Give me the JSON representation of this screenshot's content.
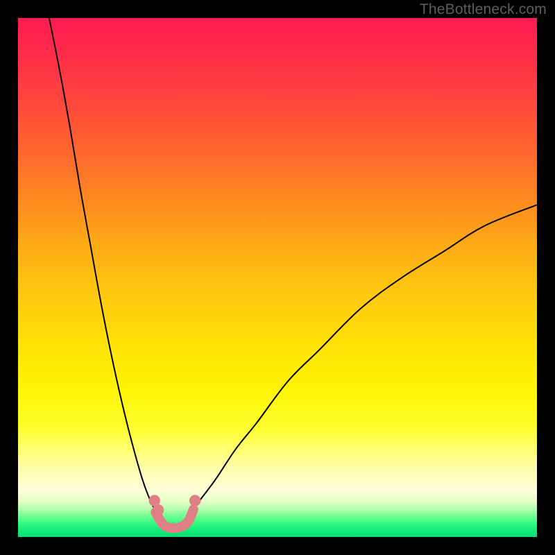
{
  "watermark": "TheBottleneck.com",
  "chart_data": {
    "type": "line",
    "title": "",
    "xlabel": "",
    "ylabel": "",
    "xlim": [
      0,
      100
    ],
    "ylim": [
      0,
      100
    ],
    "grid": false,
    "legend": false,
    "series": [
      {
        "name": "left-branch",
        "stroke": "#000000",
        "stroke_width": 2,
        "x": [
          6,
          8,
          10,
          12,
          14,
          16,
          18,
          20,
          22,
          24,
          25.5,
          27
        ],
        "y": [
          100,
          90,
          79,
          67,
          56,
          45,
          35,
          26,
          18,
          11,
          7,
          4
        ]
      },
      {
        "name": "right-branch",
        "stroke": "#000000",
        "stroke_width": 2,
        "x": [
          33,
          35,
          38,
          42,
          46,
          52,
          58,
          66,
          74,
          82,
          90,
          100
        ],
        "y": [
          4,
          7,
          11,
          17,
          22,
          30,
          36,
          44,
          50,
          55,
          60,
          64
        ]
      },
      {
        "name": "bottom-connector",
        "stroke": "#e08086",
        "stroke_width": 7,
        "x": [
          26.5,
          27.5,
          28.5,
          30,
          31.5,
          32.8,
          33.8
        ],
        "y": [
          4.8,
          3.0,
          2.0,
          1.7,
          2.0,
          3.0,
          5.3
        ]
      }
    ],
    "markers": [
      {
        "label": "left-dot-upper",
        "x": 26.3,
        "y": 7.0,
        "r": 1.1,
        "fill": "#e08086"
      },
      {
        "label": "left-dot-lower",
        "x": 27.0,
        "y": 5.2,
        "r": 1.1,
        "fill": "#e08086"
      },
      {
        "label": "right-dot",
        "x": 34.1,
        "y": 7.0,
        "r": 1.1,
        "fill": "#e08086"
      }
    ],
    "annotations": []
  }
}
